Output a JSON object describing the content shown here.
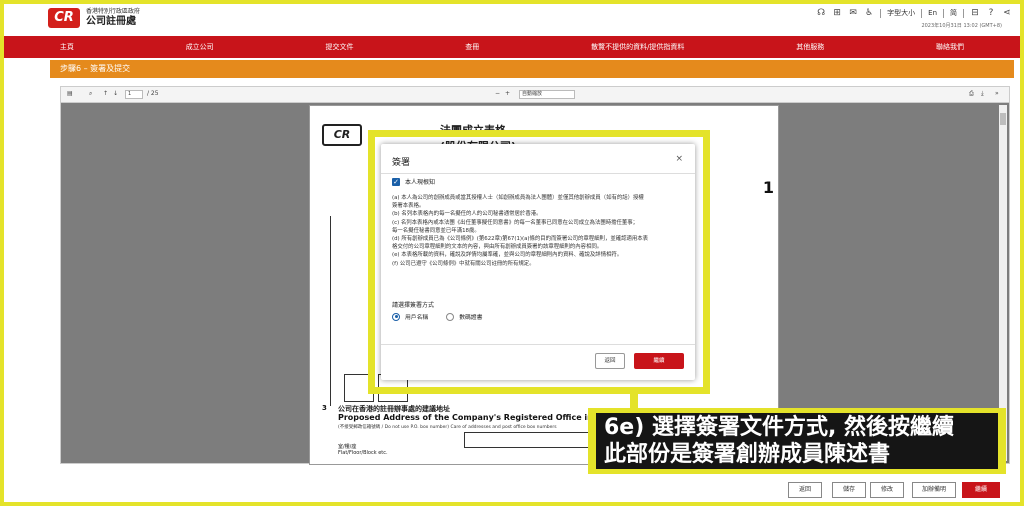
{
  "header": {
    "logo_badge": "CR",
    "gov_name": "香港特別行政區政府",
    "office_name": "公司註冊處",
    "font_size_label": "字型大小",
    "lang_label": "En",
    "lang_simplified": "简",
    "timestamp": "2023年10月31日 13:02 (GMT+8)"
  },
  "nav": {
    "items": [
      "主頁",
      "成立公司",
      "提交文件",
      "查冊",
      "散覽不提供的資料/提供指資料",
      "其他服務",
      "聯絡我們"
    ]
  },
  "stepbar": {
    "label": "步驟6 – 簽署及提交"
  },
  "viewer": {
    "page_input": "1",
    "page_total": "/ 25",
    "zoom_value": "自動縮放"
  },
  "pdf": {
    "logo": "CR",
    "title_line1": "法團成立表格",
    "title_line2": "(股份有限公司)",
    "side_digit": "1",
    "section_num": "3",
    "section_zh": "公司在香港的註冊辦事處的建議地址",
    "section_en": "Proposed Address of the Company's Registered Office in",
    "section_note": "(不接受郵政信箱號碼 / Do not use P.O. box number) Care of addresses and post office box numbers",
    "flat_zh": "室/樓/座",
    "flat_en": "Flat/Floor/Block etc."
  },
  "modal": {
    "title": "簽署",
    "close": "×",
    "checkbox_label": "本人現根知",
    "statements": [
      "(a) 本人為公司的創辦成員或當其授權人士（如創辦成員為法人團體）並僅其他創辦成員（如有的話）授權",
      "簽署本表格。",
      "(b) 名列本表格內的每一名擬任的人的公司秘書通常居於香港。",
      "(c) 名列本表格內或本法團《出任董事擬任同意書》的每一名董事已同意在公司成立為法團時擔任董事；",
      "每一名擬任秘書同意並已年滿18歲。",
      "(d) 所有創辦成員已為《公司條例》(第622章)第67(1)(a)條的目的而簽署公司的章程細則，並確認適用本表",
      "格交付的公司章程細則的文本的內容，與由所有創辦成員簽署的該章程細則的內容相同。",
      "(e) 本表格所載的資料，確說及詳情均屬準確，並與公司的章程細則內的資料、確說及詳情相符。",
      "(f) 公司已遵守《公司條例》中就有關公司註冊的所有規定。"
    ],
    "method_label": "請選擇簽署方式",
    "options": [
      "用戶名稱",
      "數碼證書"
    ],
    "back_label": "返回",
    "next_label": "繼續"
  },
  "bottom_buttons": [
    "返回",
    "儲存",
    "修改",
    "加辦備明",
    "繼續"
  ],
  "callout": {
    "line1": "6e) 選擇簽署文件方式, 然後按繼續",
    "line2": "此部份是簽署創辦成員陳述書"
  }
}
